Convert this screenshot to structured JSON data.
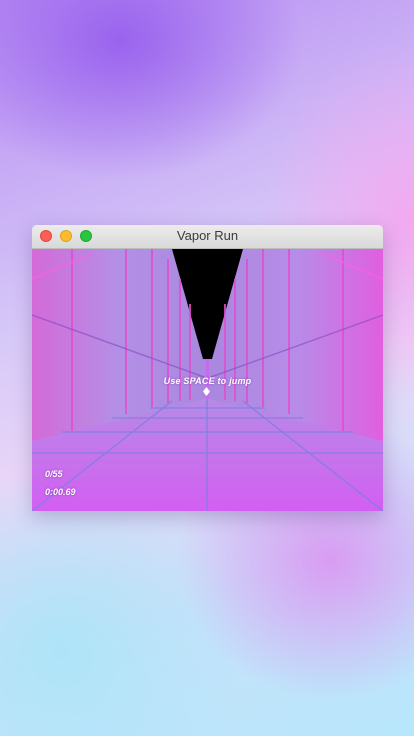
{
  "window": {
    "title": "Vapor Run"
  },
  "game": {
    "hint": "Use SPACE to jump",
    "progress": "0/55",
    "timer": "0:00.69"
  },
  "colors": {
    "wall": "#b98ae8",
    "floor": "#cd5ff0",
    "sky": "#000000",
    "accent_pink": "#ff3fd8"
  },
  "icons": {
    "close": "traffic-light-red",
    "minimize": "traffic-light-yellow",
    "zoom": "traffic-light-green"
  }
}
